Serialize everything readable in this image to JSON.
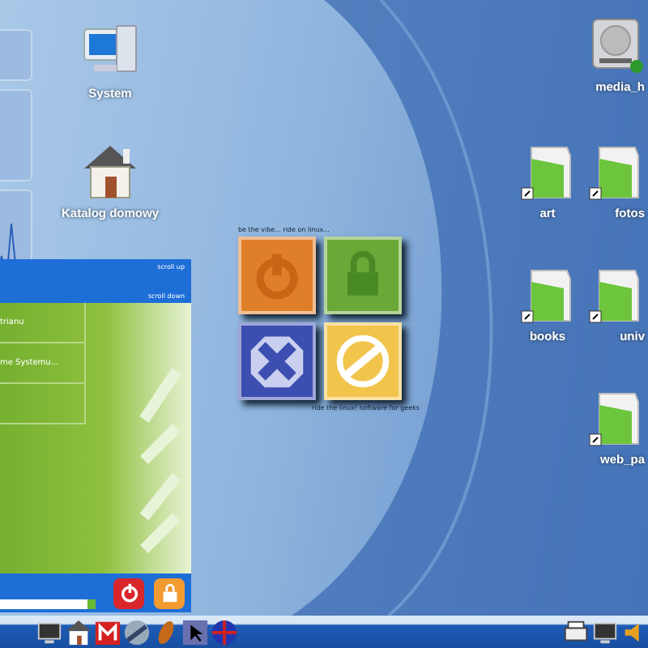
{
  "desktop_icons": [
    {
      "kind": "computer",
      "label": "System"
    },
    {
      "kind": "house",
      "label": "Katalog domowy"
    },
    {
      "kind": "drive",
      "label": "media_h"
    },
    {
      "kind": "folder",
      "label": "art"
    },
    {
      "kind": "folder",
      "label": "fotos"
    },
    {
      "kind": "folder",
      "label": "books"
    },
    {
      "kind": "folder",
      "label": "univ"
    },
    {
      "kind": "folder",
      "label": "web_pa"
    }
  ],
  "logout_panel": {
    "caption_top": "be the vibe... ride on linux...",
    "caption_bottom": "ride the linux! software for geeks",
    "tiles": [
      {
        "kind": "power",
        "color": "#e07f2a"
      },
      {
        "kind": "lock",
        "color": "#6aa837"
      },
      {
        "kind": "cancel",
        "color": "#3c4fb0"
      },
      {
        "kind": "ring",
        "color": "#f1c54c"
      }
    ]
  },
  "start_menu": {
    "scroll_up": "scroll up",
    "scroll_down": "scroll down",
    "items": [
      "trianu",
      "me Systemu..."
    ]
  },
  "taskbar": {
    "launchers": [
      {
        "kind": "monitor"
      },
      {
        "kind": "house"
      },
      {
        "kind": "mail"
      },
      {
        "kind": "disc"
      },
      {
        "kind": "feather"
      },
      {
        "kind": "cursor"
      },
      {
        "kind": "globe"
      }
    ],
    "tray": [
      {
        "kind": "printer"
      },
      {
        "kind": "monitor"
      },
      {
        "kind": "speaker"
      }
    ]
  }
}
